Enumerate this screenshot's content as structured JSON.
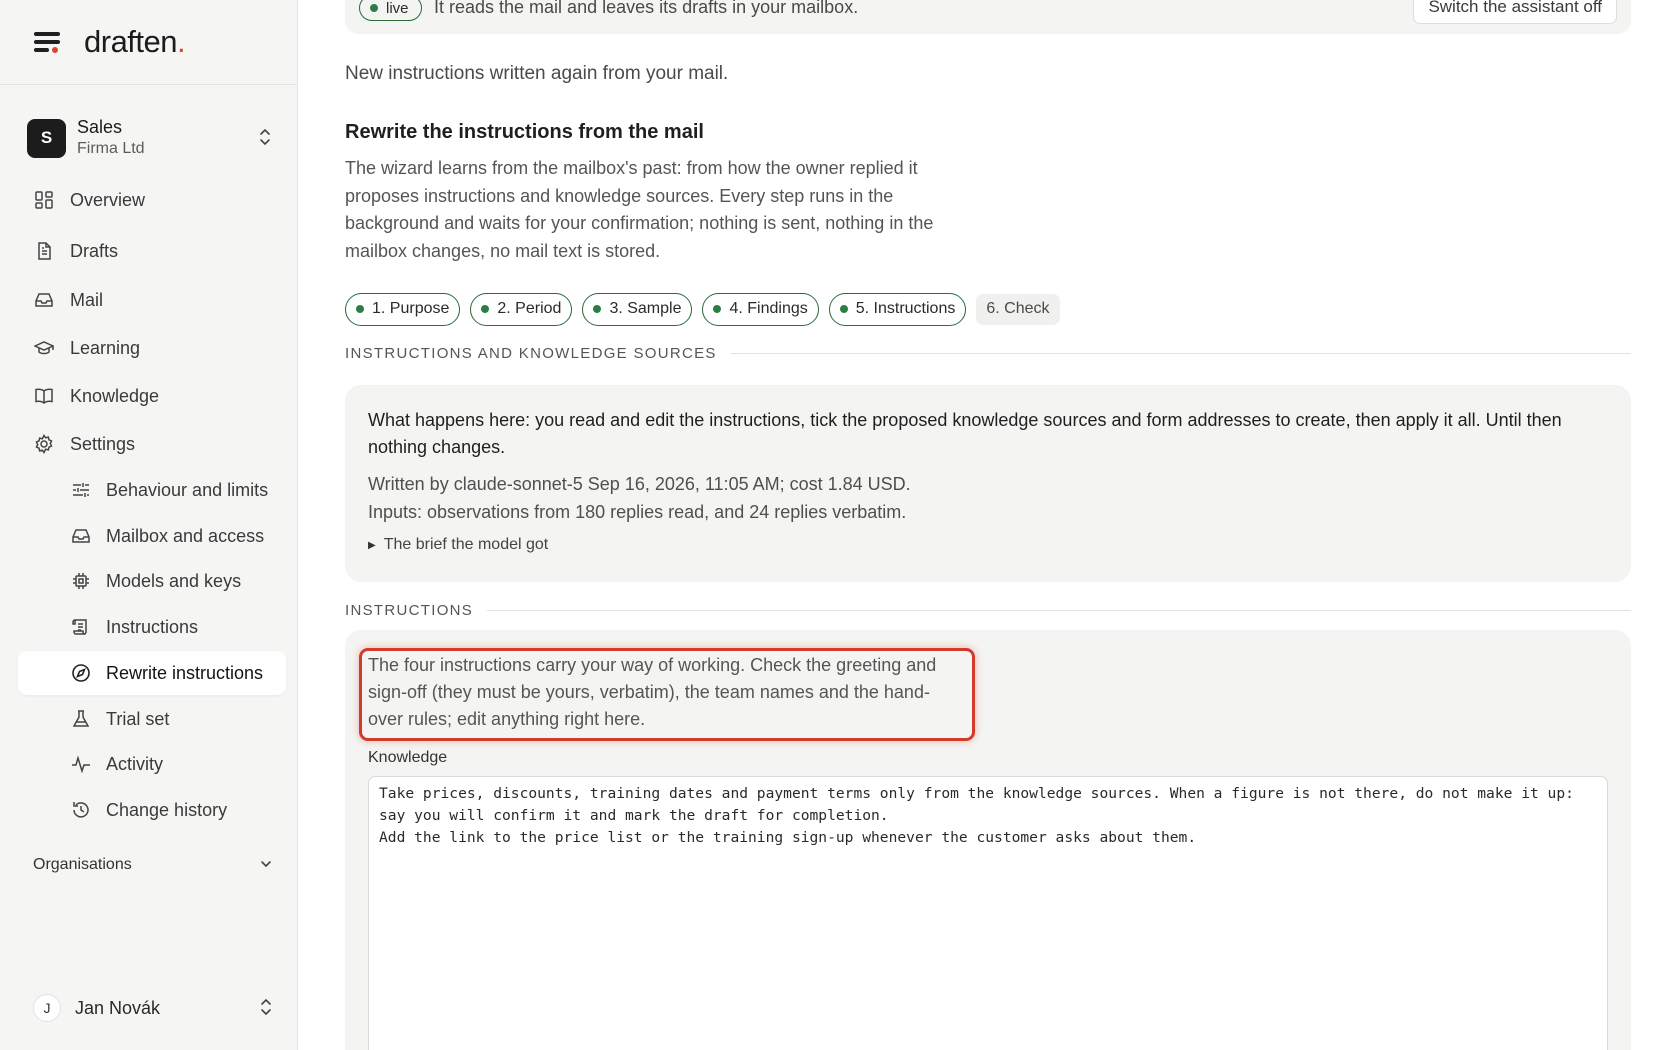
{
  "brand": {
    "logo_text": "draften",
    "logo_dot": "."
  },
  "workspace": {
    "initial": "S",
    "name": "Sales",
    "org": "Firma Ltd"
  },
  "nav": {
    "items": [
      {
        "label": "Overview",
        "icon": "grid-icon"
      },
      {
        "label": "Drafts",
        "icon": "document-icon"
      },
      {
        "label": "Mail",
        "icon": "inbox-icon"
      },
      {
        "label": "Learning",
        "icon": "graduation-cap-icon"
      },
      {
        "label": "Knowledge",
        "icon": "book-icon"
      },
      {
        "label": "Settings",
        "icon": "gear-icon"
      }
    ],
    "sub_items": [
      {
        "label": "Behaviour and limits",
        "icon": "sliders-icon"
      },
      {
        "label": "Mailbox and access",
        "icon": "inbox-icon"
      },
      {
        "label": "Models and keys",
        "icon": "chip-icon"
      },
      {
        "label": "Instructions",
        "icon": "scroll-icon"
      },
      {
        "label": "Rewrite instructions",
        "icon": "compass-icon",
        "active": true
      },
      {
        "label": "Trial set",
        "icon": "flask-icon"
      },
      {
        "label": "Activity",
        "icon": "activity-icon"
      },
      {
        "label": "Change history",
        "icon": "history-icon"
      }
    ],
    "organisations_label": "Organisations"
  },
  "user": {
    "initial": "J",
    "name": "Jan Novák"
  },
  "topbar": {
    "status": "live",
    "text": "It reads the mail and leaves its drafts in your mailbox.",
    "switch_label": "Switch the assistant off"
  },
  "page": {
    "subtitle": "New instructions written again from your mail.",
    "title": "Rewrite the instructions from the mail",
    "lead": "The wizard learns from the mailbox's past: from how the owner replied it proposes instructions and knowledge sources. Every step runs in the background and waits for your confirmation; nothing is sent, nothing in the mailbox changes, no mail text is stored."
  },
  "steps": [
    {
      "label": "1. Purpose",
      "done": true
    },
    {
      "label": "2. Period",
      "done": true
    },
    {
      "label": "3. Sample",
      "done": true
    },
    {
      "label": "4. Findings",
      "done": true
    },
    {
      "label": "5. Instructions",
      "done": true
    },
    {
      "label": "6. Check",
      "done": false
    }
  ],
  "sections": {
    "sources_heading": "INSTRUCTIONS AND KNOWLEDGE SOURCES",
    "instructions_heading": "INSTRUCTIONS"
  },
  "summary_card": {
    "what_happens": "What happens here: you read and edit the instructions, tick the proposed knowledge sources and form addresses to create, then apply it all. Until then nothing changes.",
    "written_by": "Written by claude-sonnet-5 Sep 16, 2026, 11:05 AM; cost 1.84 USD.",
    "inputs": "Inputs: observations from 180 replies read, and 24 replies verbatim.",
    "brief_toggle": "The brief the model got"
  },
  "instructions_card": {
    "note": "The four instructions carry your way of working. Check the greeting and sign-off (they must be yours, verbatim), the team names and the hand-over rules; edit anything right here.",
    "knowledge_label": "Knowledge",
    "knowledge_text": "Take prices, discounts, training dates and payment terms only from the knowledge sources. When a figure is not there, do not make it up: say you will confirm it and mark the draft for completion.\nAdd the link to the price list or the training sign-up whenever the customer asks about them."
  },
  "colors": {
    "accent_red": "#d23a2c",
    "status_green": "#2e7d45",
    "sidebar_bg": "#f5f5f4"
  }
}
